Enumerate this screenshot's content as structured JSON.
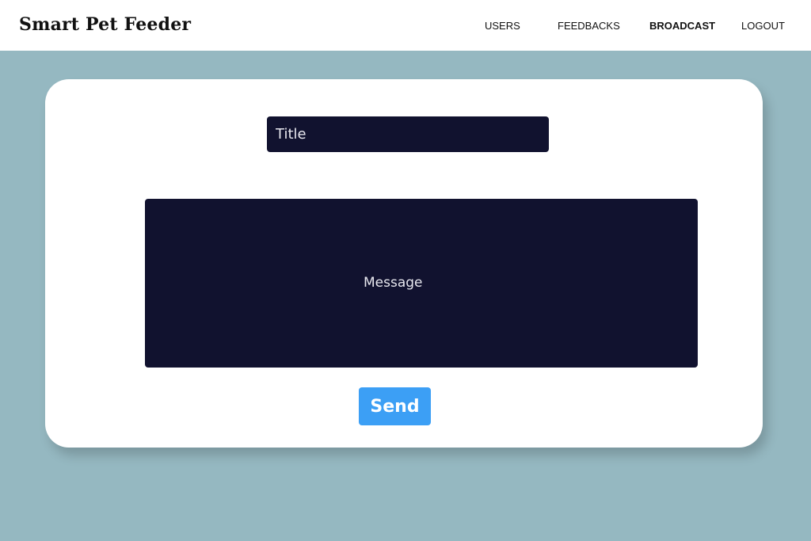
{
  "header": {
    "brand": "Smart Pet Feeder",
    "nav": {
      "users": "USERS",
      "feedbacks": "FEEDBACKS",
      "broadcast": "BROADCAST",
      "logout": "LOGOUT"
    },
    "active_nav": "broadcast"
  },
  "form": {
    "title_placeholder": "Title",
    "title_value": "",
    "message_placeholder": "Message",
    "message_value": "",
    "send_label": "Send"
  },
  "colors": {
    "background": "#95b8c1",
    "card": "#ffffff",
    "input_bg": "#11122f",
    "button": "#3c9ff5"
  }
}
